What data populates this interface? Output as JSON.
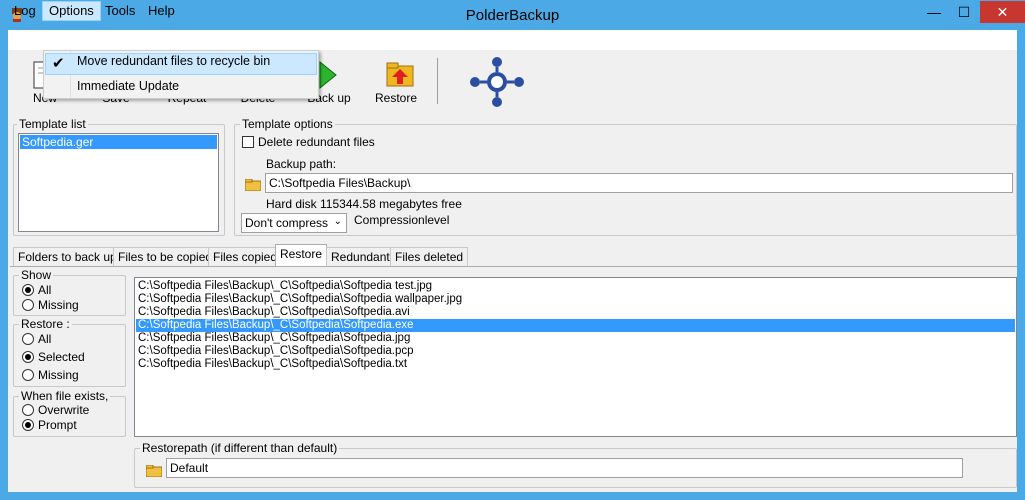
{
  "window": {
    "title": "PolderBackup",
    "minimize": "—",
    "maximize": "☐",
    "close": "✕"
  },
  "menu": {
    "items": [
      "Log",
      "Options",
      "Tools",
      "Help"
    ]
  },
  "dropdown": {
    "items": [
      {
        "label": "Move redundant files to recycle bin",
        "checked": true
      },
      {
        "label": "Immediate Update",
        "checked": false
      }
    ],
    "check_glyph": "✔"
  },
  "toolbar": {
    "labels": [
      "New",
      "Save",
      "Repeat",
      "Delete",
      "Back up",
      "Restore"
    ]
  },
  "template_list": {
    "title": "Template list",
    "items": [
      "Softpedia.ger"
    ]
  },
  "template_options": {
    "title": "Template options",
    "delete_redundant_label": "Delete redundant files",
    "backup_path_label": "Backup path:",
    "backup_path_value": "C:\\Softpedia Files\\Backup\\",
    "hard_disk_info": "Hard disk 115344.58 megabytes free",
    "compression_value": "Don't compress",
    "compression_label": "Compressionlevel"
  },
  "tabs": [
    "Folders to back up",
    "Files to be copied",
    "Files copied",
    "Restore",
    "Redundant",
    "Files deleted"
  ],
  "active_tab": "Restore",
  "show_group": {
    "title": "Show",
    "options": [
      "All",
      "Missing"
    ],
    "selected": "All"
  },
  "restore_group": {
    "title": "Restore :",
    "options": [
      "All",
      "Selected",
      "Missing"
    ],
    "selected": "Selected"
  },
  "when_exists_group": {
    "title": "When file exists,",
    "options": [
      "Overwrite",
      "Prompt"
    ],
    "selected": "Prompt"
  },
  "files": [
    {
      "path": "C:\\Softpedia Files\\Backup\\_C\\Softpedia\\Softpedia test.jpg",
      "selected": false
    },
    {
      "path": "C:\\Softpedia Files\\Backup\\_C\\Softpedia\\Softpedia wallpaper.jpg",
      "selected": false
    },
    {
      "path": "C:\\Softpedia Files\\Backup\\_C\\Softpedia\\Softpedia.avi",
      "selected": false
    },
    {
      "path": "C:\\Softpedia Files\\Backup\\_C\\Softpedia\\Softpedia.exe",
      "selected": true
    },
    {
      "path": "C:\\Softpedia Files\\Backup\\_C\\Softpedia\\Softpedia.jpg",
      "selected": false
    },
    {
      "path": "C:\\Softpedia Files\\Backup\\_C\\Softpedia\\Softpedia.pcp",
      "selected": false
    },
    {
      "path": "C:\\Softpedia Files\\Backup\\_C\\Softpedia\\Softpedia.txt",
      "selected": false
    }
  ],
  "restorepath": {
    "title": "Restorepath (if different than default)",
    "value": "Default"
  },
  "colors": {
    "titlebar": "#4ba9e6",
    "close_button": "#c7372f",
    "selection": "#3399ff",
    "menu_highlight": "#cce8ff"
  }
}
